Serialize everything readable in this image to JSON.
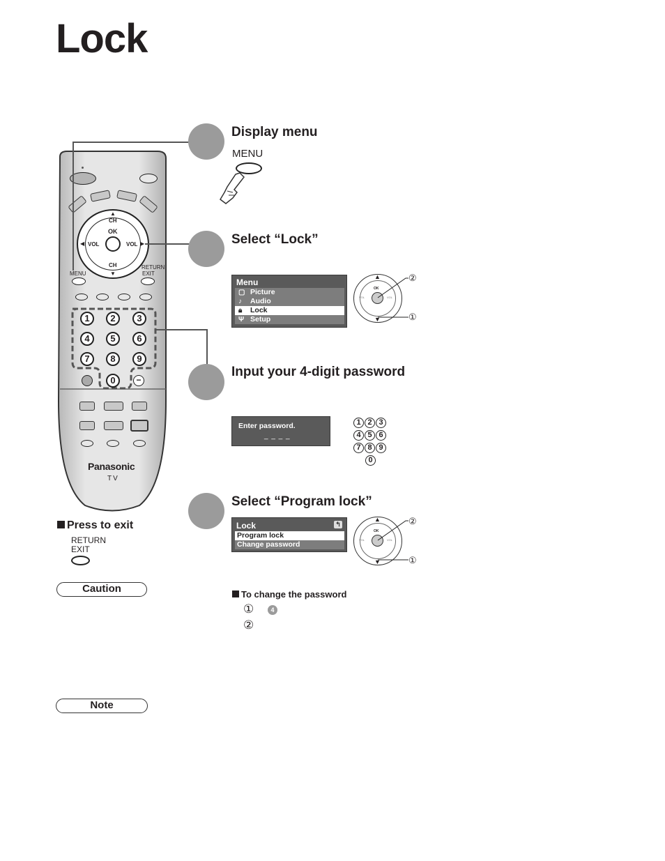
{
  "page": {
    "title": "Lock"
  },
  "steps": [
    {
      "title": "Display menu",
      "button_label": "MENU"
    },
    {
      "title": "Select “Lock”"
    },
    {
      "title": "Input your 4-digit password"
    },
    {
      "title": "Select “Program lock”"
    }
  ],
  "menu_osd": {
    "header": "Menu",
    "items": [
      {
        "icon": "picture-icon",
        "label": "Picture",
        "selected": false
      },
      {
        "icon": "audio-icon",
        "label": "Audio",
        "selected": false
      },
      {
        "icon": "lock-icon",
        "label": "Lock",
        "selected": true
      },
      {
        "icon": "setup-icon",
        "label": "Setup",
        "selected": false
      }
    ]
  },
  "password_osd": {
    "prompt": "Enter password.",
    "placeholder": "_ _ _ _"
  },
  "lock_osd": {
    "header": "Lock",
    "items": [
      {
        "label": "Program lock",
        "selected": true
      },
      {
        "label": "Change password",
        "selected": false
      }
    ]
  },
  "dpad": {
    "ok": "OK",
    "ch": "CH",
    "vol": "VOL",
    "callout_1": "①",
    "callout_2": "②"
  },
  "numpad": [
    "1",
    "2",
    "3",
    "4",
    "5",
    "6",
    "7",
    "8",
    "9",
    "0"
  ],
  "remote": {
    "menu_label": "MENU",
    "return_label": "RETURN",
    "exit_label": "EXIT",
    "ok_label": "OK",
    "ch_label": "CH",
    "vol_label": "VOL",
    "brand": "Panasonic",
    "model": "TV"
  },
  "press_to_exit": {
    "heading": "Press to exit",
    "line1": "RETURN",
    "line2": "EXIT"
  },
  "change_password": {
    "heading": "To change the password",
    "step1_num": "①",
    "step1_ref": "4",
    "step2_num": "②"
  },
  "caution_label": "Caution",
  "note_label": "Note"
}
